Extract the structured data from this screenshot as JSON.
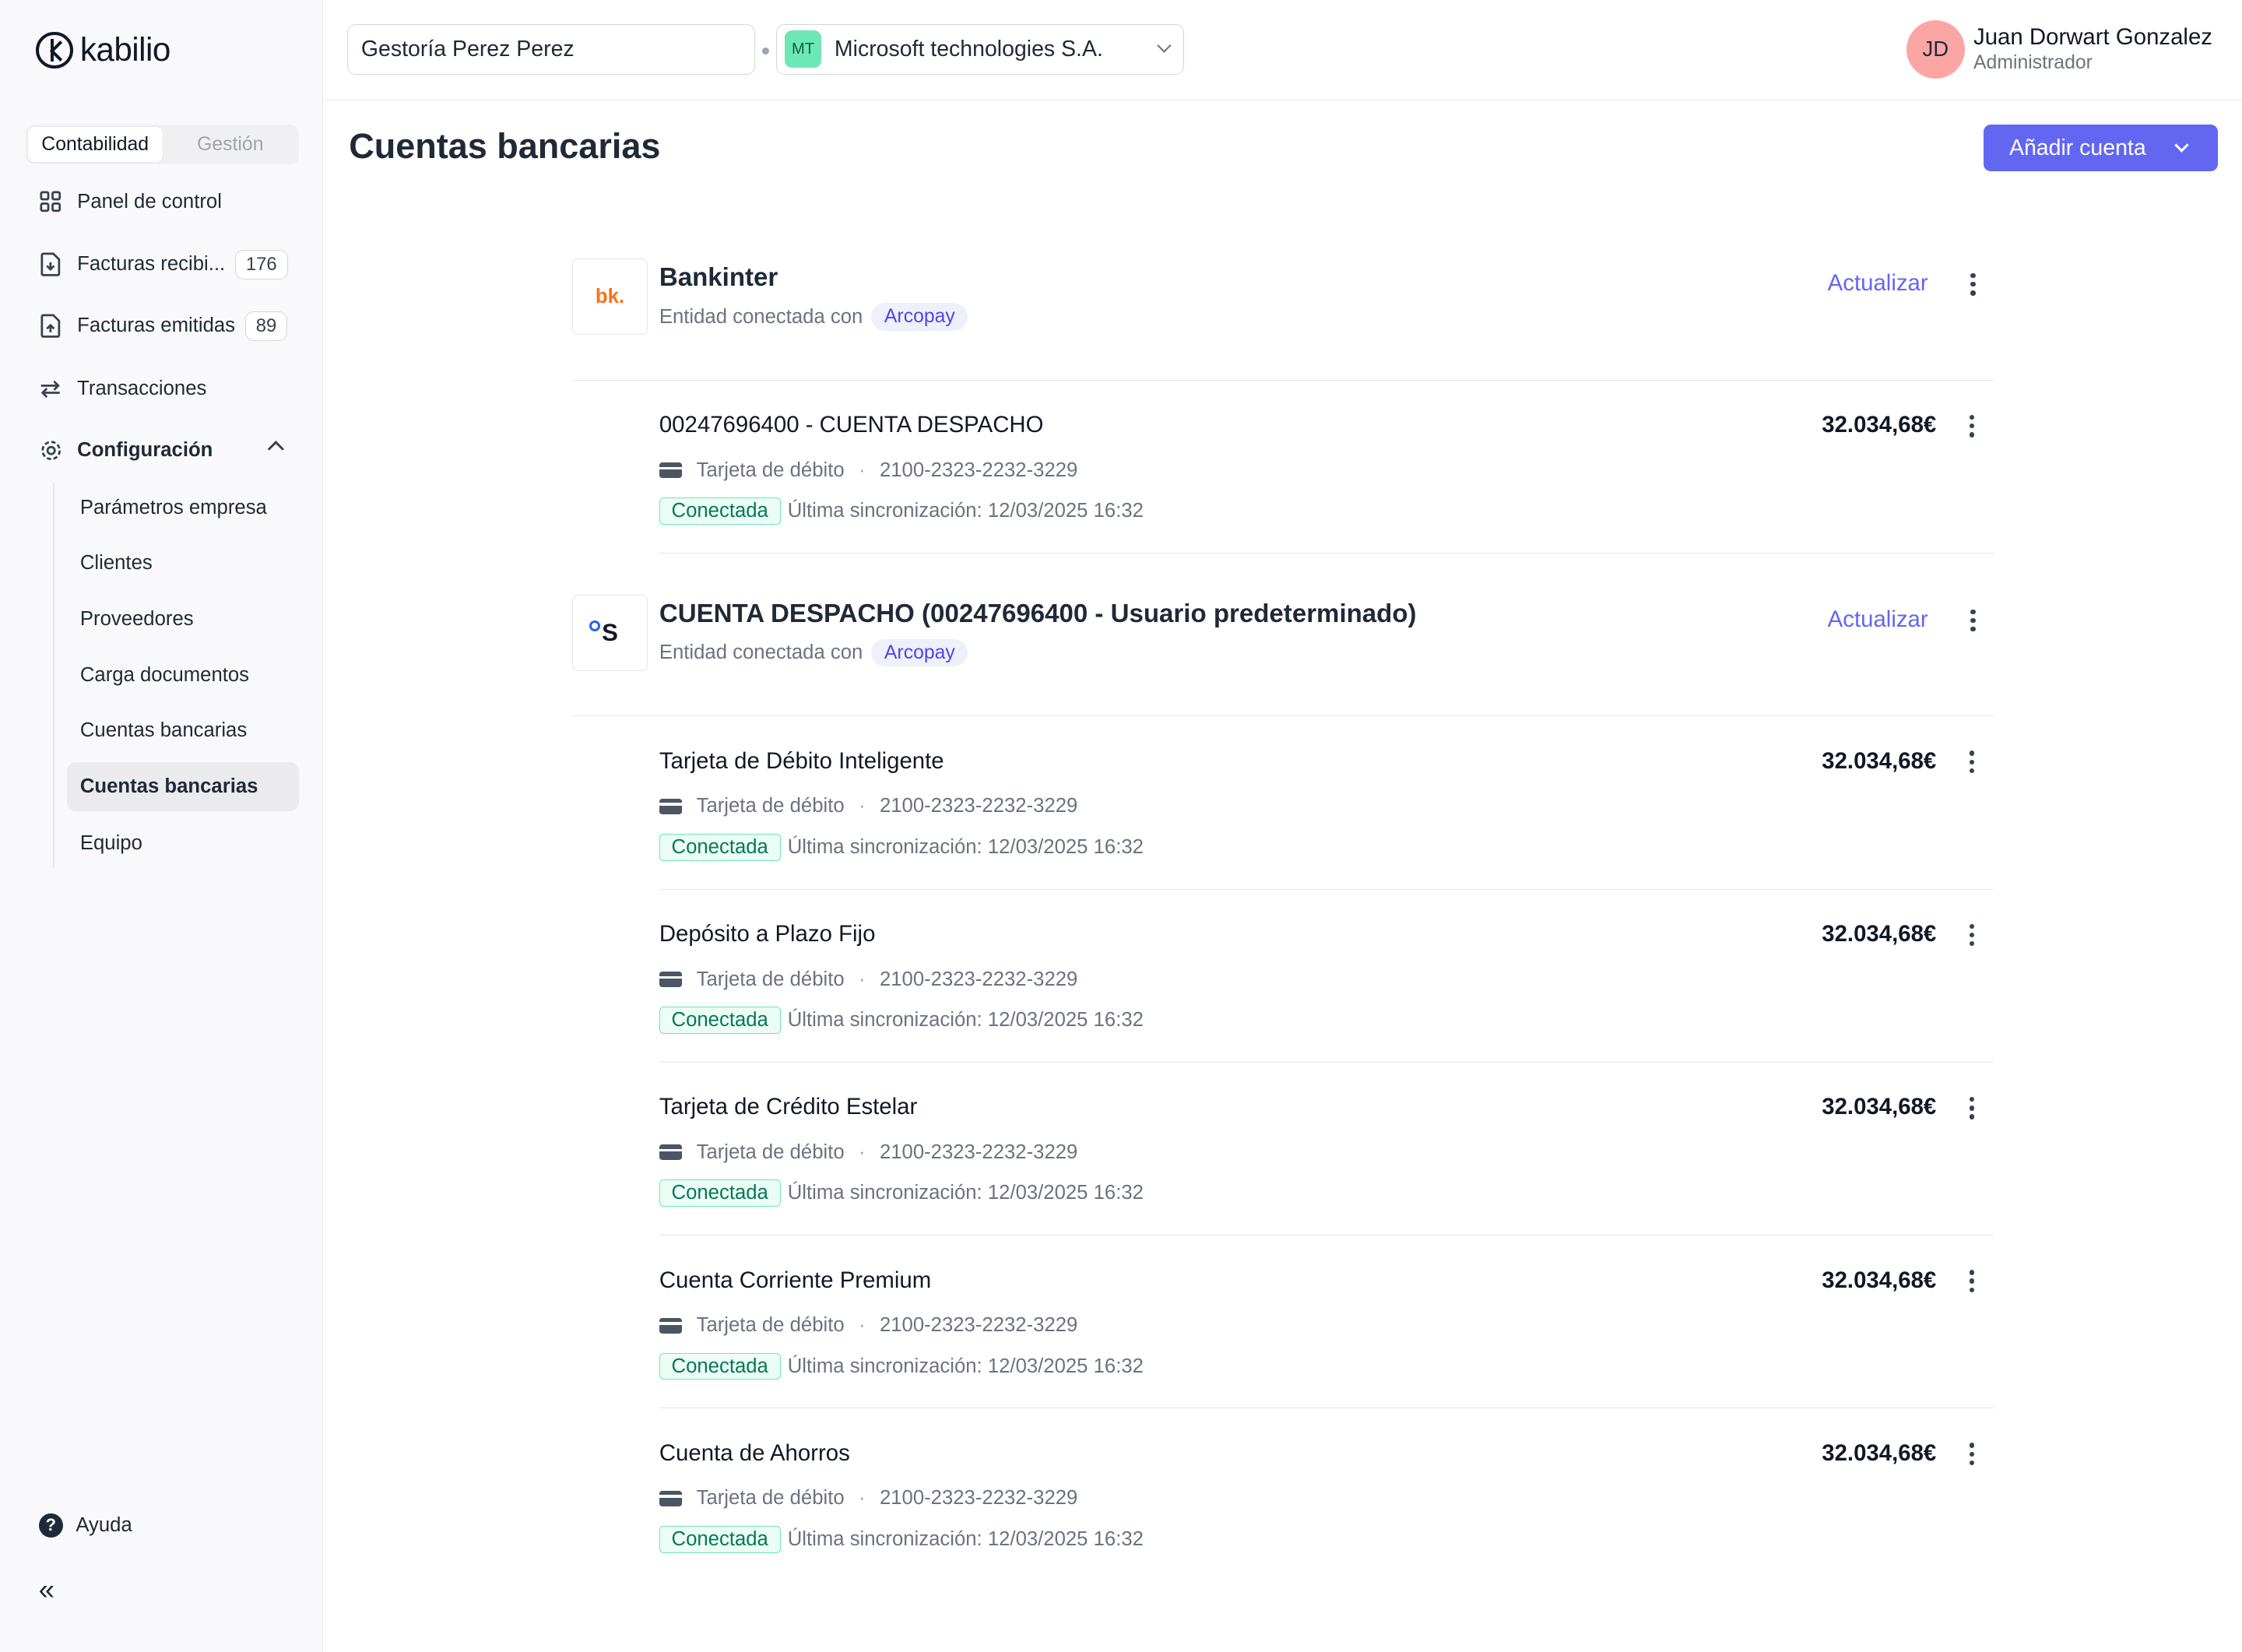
{
  "app": {
    "logo_text": "kabilio"
  },
  "sidebar": {
    "tabs": [
      "Contabilidad",
      "Gestión"
    ],
    "items": [
      {
        "label": "Panel de control",
        "icon": "grid-icon"
      },
      {
        "label": "Facturas recibi...",
        "icon": "file-download-icon",
        "badge": "176"
      },
      {
        "label": "Facturas emitidas",
        "icon": "file-upload-icon",
        "badge": "89"
      },
      {
        "label": "Transacciones",
        "icon": "arrows-swap-icon"
      },
      {
        "label": "Configuración",
        "icon": "gear-icon"
      }
    ],
    "sub_items": [
      "Parámetros empresa",
      "Clientes",
      "Proveedores",
      "Carga documentos",
      "Cuentas bancarias",
      "Cuentas bancarias",
      "Equipo"
    ],
    "help": "Ayuda",
    "collapse": "«"
  },
  "topbar": {
    "gestoria": "Gestoría Perez Perez",
    "company_initials": "MT",
    "company": "Microsoft technologies S.A.",
    "user_initials": "JD",
    "user_name": "Juan Dorwart Gonzalez",
    "user_role": "Administrador"
  },
  "main": {
    "title": "Cuentas bancarias",
    "add_button": "Añadir cuenta",
    "entities": [
      {
        "logo": "bk.",
        "name": "Bankinter",
        "connected_with_label": "Entidad conectada con",
        "provider": "Arcopay",
        "update_label": "Actualizar",
        "accounts": [
          {
            "name": "00247696400 - CUENTA DESPACHO",
            "amount": "32.034,68€",
            "type": "Tarjeta de débito",
            "number": "2100-2323-2232-3229",
            "status": "Conectada",
            "sync": "Última sincronización: 12/03/2025 16:32"
          }
        ]
      },
      {
        "logo": "S",
        "name": "CUENTA DESPACHO (00247696400 - Usuario predeterminado)",
        "connected_with_label": "Entidad conectada con",
        "provider": "Arcopay",
        "update_label": "Actualizar",
        "accounts": [
          {
            "name": "Tarjeta de Débito Inteligente",
            "amount": "32.034,68€",
            "type": "Tarjeta de débito",
            "number": "2100-2323-2232-3229",
            "status": "Conectada",
            "sync": "Última sincronización: 12/03/2025 16:32"
          },
          {
            "name": "Depósito a Plazo Fijo",
            "amount": "32.034,68€",
            "type": "Tarjeta de débito",
            "number": "2100-2323-2232-3229",
            "status": "Conectada",
            "sync": "Última sincronización: 12/03/2025 16:32"
          },
          {
            "name": "Tarjeta de Crédito Estelar",
            "amount": "32.034,68€",
            "type": "Tarjeta de débito",
            "number": "2100-2323-2232-3229",
            "status": "Conectada",
            "sync": "Última sincronización: 12/03/2025 16:32"
          },
          {
            "name": "Cuenta Corriente Premium",
            "amount": "32.034,68€",
            "type": "Tarjeta de débito",
            "number": "2100-2323-2232-3229",
            "status": "Conectada",
            "sync": "Última sincronización: 12/03/2025 16:32"
          },
          {
            "name": "Cuenta de Ahorros",
            "amount": "32.034,68€",
            "type": "Tarjeta de débito",
            "number": "2100-2323-2232-3229",
            "status": "Conectada",
            "sync": "Última sincronización: 12/03/2025 16:32"
          }
        ]
      }
    ]
  },
  "colors": {
    "accent": "#6366f1",
    "status_green": "#047857"
  }
}
